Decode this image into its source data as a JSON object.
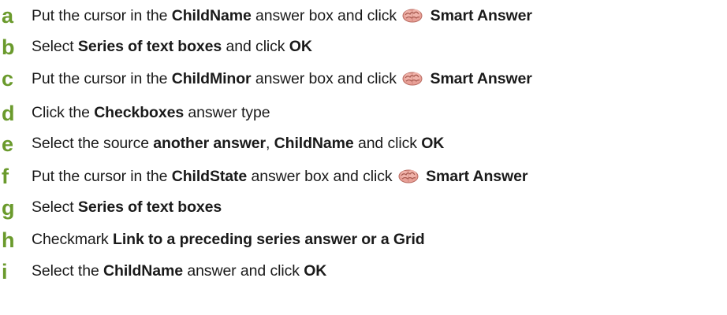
{
  "steps": [
    {
      "letter": "a",
      "parts": [
        {
          "t": "Put the cursor in the ",
          "b": false
        },
        {
          "t": "ChildName",
          "b": true
        },
        {
          "t": " answer box and click ",
          "b": false
        },
        {
          "icon": "brain-icon"
        },
        {
          "t": "Smart Answer",
          "b": true
        }
      ]
    },
    {
      "letter": "b",
      "parts": [
        {
          "t": "Select ",
          "b": false
        },
        {
          "t": "Series of text boxes",
          "b": true
        },
        {
          "t": " and click ",
          "b": false
        },
        {
          "t": "OK",
          "b": true
        }
      ]
    },
    {
      "letter": "c",
      "parts": [
        {
          "t": "Put the cursor in the ",
          "b": false
        },
        {
          "t": "ChildMinor",
          "b": true
        },
        {
          "t": " answer box and click ",
          "b": false
        },
        {
          "icon": "brain-icon"
        },
        {
          "t": "Smart Answer",
          "b": true
        }
      ]
    },
    {
      "letter": "d",
      "parts": [
        {
          "t": "Click the ",
          "b": false
        },
        {
          "t": "Checkboxes",
          "b": true
        },
        {
          "t": " answer type",
          "b": false
        }
      ]
    },
    {
      "letter": "e",
      "parts": [
        {
          "t": "Select the source ",
          "b": false
        },
        {
          "t": "another answer",
          "b": true
        },
        {
          "t": ", ",
          "b": false
        },
        {
          "t": "ChildName",
          "b": true
        },
        {
          "t": " and click ",
          "b": false
        },
        {
          "t": "OK",
          "b": true
        }
      ]
    },
    {
      "letter": "f",
      "parts": [
        {
          "t": "Put the cursor in the ",
          "b": false
        },
        {
          "t": "ChildState",
          "b": true
        },
        {
          "t": " answer box and click ",
          "b": false
        },
        {
          "icon": "brain-icon"
        },
        {
          "t": "Smart Answer",
          "b": true
        }
      ]
    },
    {
      "letter": "g",
      "parts": [
        {
          "t": "Select ",
          "b": false
        },
        {
          "t": "Series of text boxes",
          "b": true
        }
      ]
    },
    {
      "letter": "h",
      "parts": [
        {
          "t": "Checkmark ",
          "b": false
        },
        {
          "t": "Link to a preceding series answer or a Grid",
          "b": true
        }
      ]
    },
    {
      "letter": "i",
      "parts": [
        {
          "t": "Select the ",
          "b": false
        },
        {
          "t": "ChildName",
          "b": true
        },
        {
          "t": " answer and click ",
          "b": false
        },
        {
          "t": "OK",
          "b": true
        }
      ]
    }
  ],
  "colors": {
    "step_letter": "#6a9a2c",
    "text": "#1a1a1a",
    "brain_icon": "#e8a097"
  }
}
